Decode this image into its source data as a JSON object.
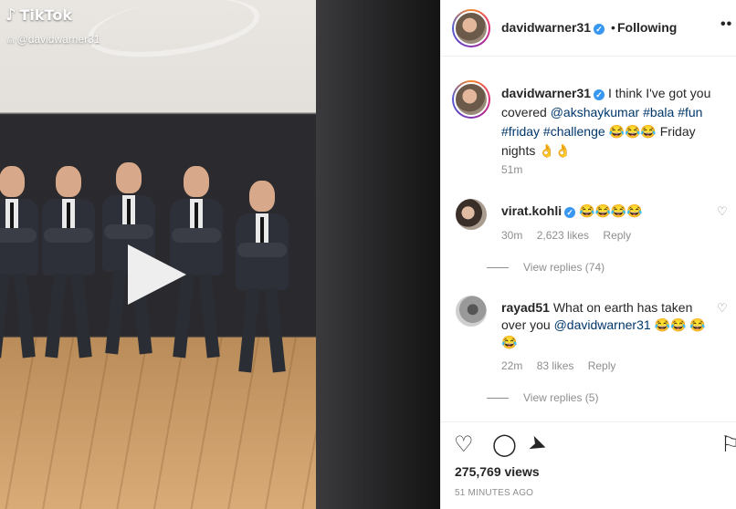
{
  "video": {
    "watermark_brand": "TikTok",
    "watermark_handle": "@davidwarner31",
    "play_icon": "play-icon"
  },
  "post": {
    "username": "davidwarner31",
    "follow_status": "Following",
    "separator": "•",
    "more_icon": "more-options-icon"
  },
  "caption": {
    "username": "davidwarner31",
    "text_intro": "I think I've got you covered",
    "mention": "@akshaykumar",
    "tags": [
      "#bala",
      "#fun",
      "#friday",
      "#challenge"
    ],
    "emojis": "😂😂😂",
    "text_outro": "Friday nights",
    "outro_emojis": "👌👌",
    "time": "51m"
  },
  "comments": [
    {
      "username": "virat.kohli",
      "verified": true,
      "text": "😂😂😂😂",
      "time": "30m",
      "likes": "2,623 likes",
      "reply_label": "Reply",
      "view_replies": "View replies (74)"
    },
    {
      "username": "rayad51",
      "verified": false,
      "text": "What on earth has taken over you",
      "mention": "@davidwarner31",
      "emojis": "😂😂",
      "emojis_line2": "😂😂",
      "time": "22m",
      "likes": "83 likes",
      "reply_label": "Reply",
      "view_replies": "View replies (5)"
    }
  ],
  "actions": {
    "icons": [
      "heart-icon",
      "comment-icon",
      "share-icon",
      "bookmark-icon"
    ],
    "views": "275,769 views",
    "posted": "51 MINUTES AGO"
  },
  "colors": {
    "link": "#00376b",
    "verified": "#3897f0",
    "muted": "#8e8e8e",
    "text": "#262626"
  }
}
